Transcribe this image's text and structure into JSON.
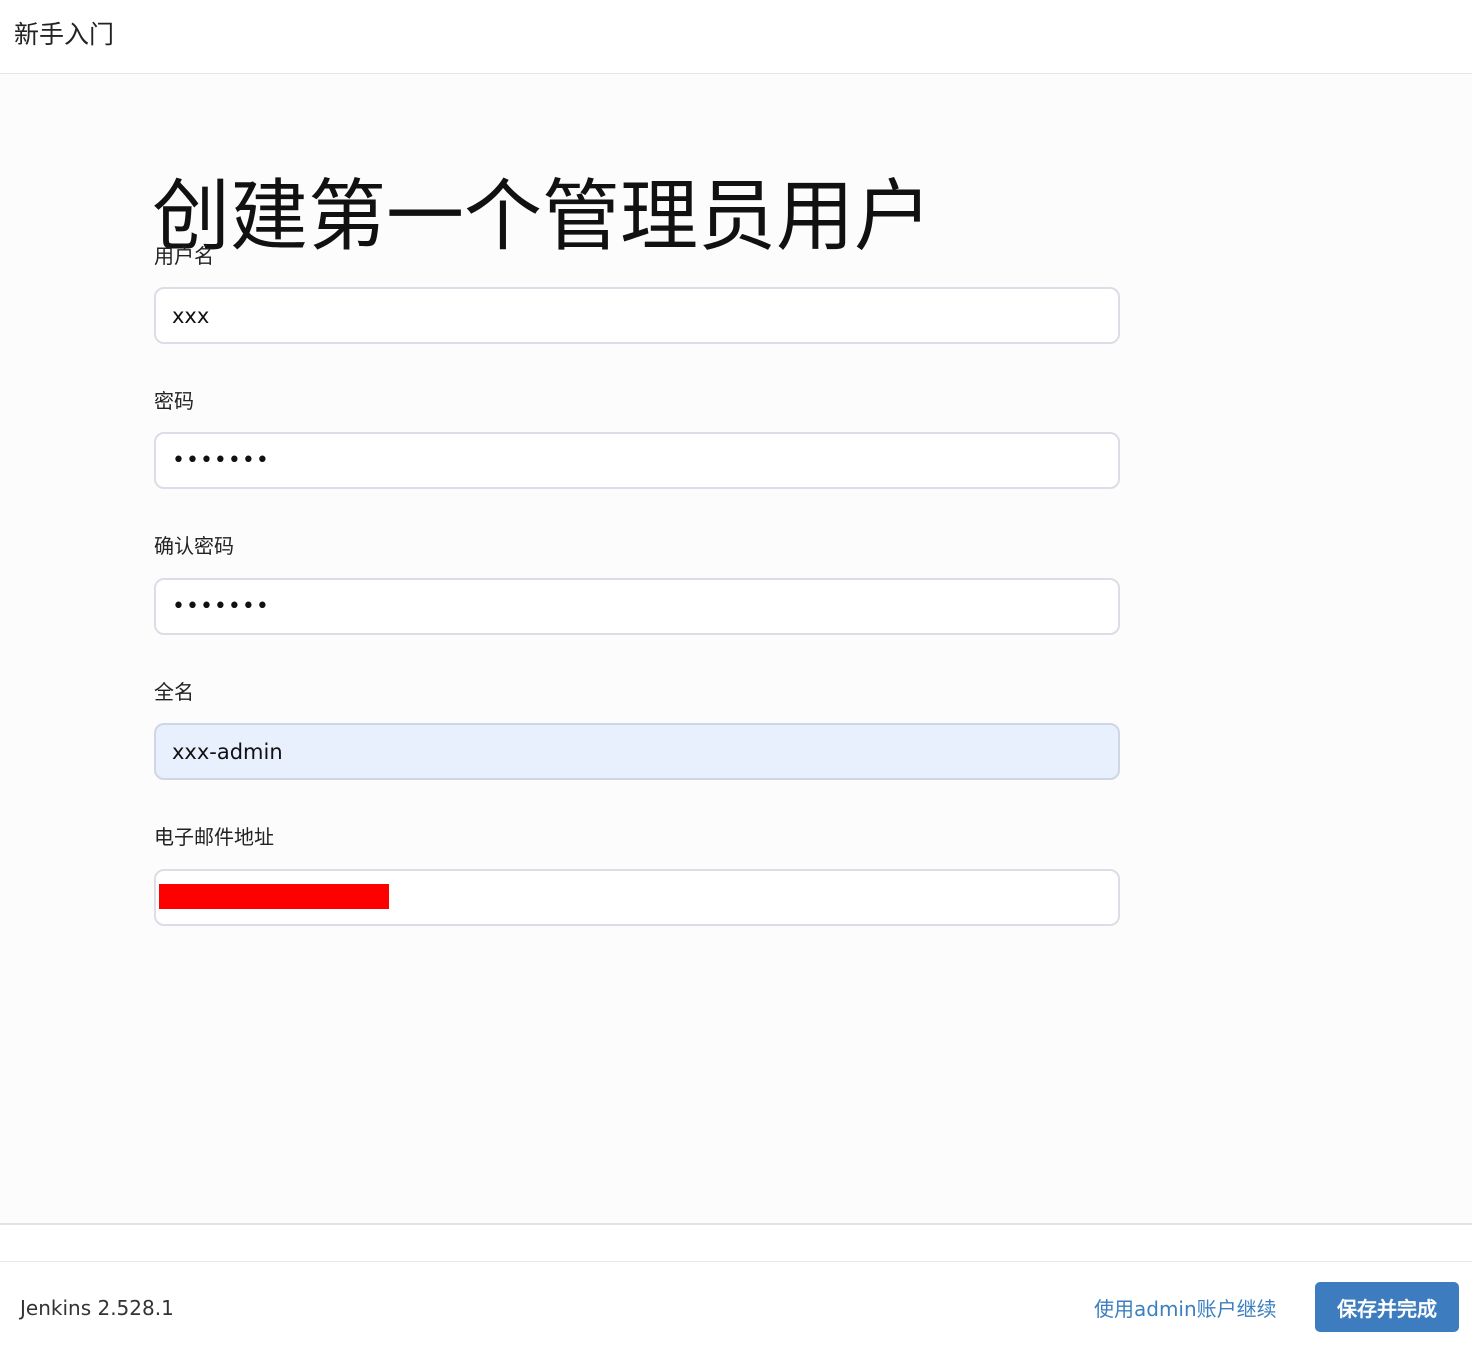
{
  "header": {
    "title": "新手入门"
  },
  "form": {
    "title": "创建第一个管理员用户",
    "username": {
      "label": "用户名",
      "value": "xxx"
    },
    "password": {
      "label": "密码",
      "value": "•••••••"
    },
    "confirm_password": {
      "label": "确认密码",
      "value": "•••••••"
    },
    "full_name": {
      "label": "全名",
      "value": "xxx-admin"
    },
    "email": {
      "label": "电子邮件地址",
      "value": ""
    }
  },
  "footer": {
    "version": "Jenkins 2.528.1",
    "skip_link": "使用admin账户继续",
    "save_button": "保存并完成"
  },
  "colors": {
    "primary_button": "#3d7dbf",
    "link": "#3b7fc0",
    "autofill_background": "#e8f0fe",
    "redaction": "#ff0000"
  }
}
